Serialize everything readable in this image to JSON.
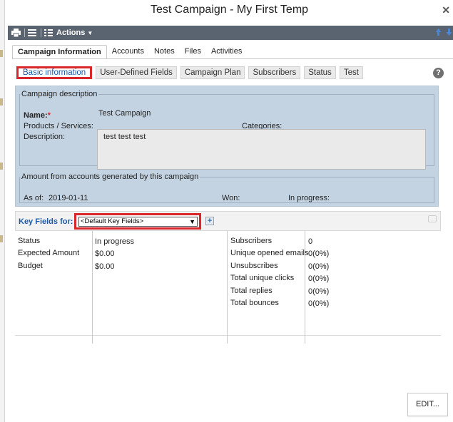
{
  "window": {
    "title": "Test Campaign - My First Temp"
  },
  "toolbar": {
    "actions_label": "Actions"
  },
  "tabs": [
    {
      "label": "Campaign Information",
      "active": true
    },
    {
      "label": "Accounts"
    },
    {
      "label": "Notes"
    },
    {
      "label": "Files"
    },
    {
      "label": "Activities"
    }
  ],
  "subtabs": [
    {
      "label": "Basic information",
      "active": true
    },
    {
      "label": "User-Defined Fields"
    },
    {
      "label": "Campaign Plan"
    },
    {
      "label": "Subscribers"
    },
    {
      "label": "Status"
    },
    {
      "label": "Test"
    }
  ],
  "campaign_description": {
    "legend": "Campaign description",
    "name_label": "Name:",
    "name_required": "*",
    "name_value": "Test Campaign",
    "products_label": "Products / Services:",
    "categories_label": "Categories:",
    "description_label": "Description:",
    "description_value": "test test test"
  },
  "amount": {
    "legend": "Amount from accounts generated by this campaign",
    "as_of_label": "As of:",
    "as_of_value": "2019-01-11",
    "won_label": "Won:",
    "in_progress_label": "In progress:"
  },
  "key_fields": {
    "label": "Key Fields for:",
    "selected": "<Default Key Fields>",
    "left": [
      {
        "label": "Status",
        "value": "In progress"
      },
      {
        "label": "Expected Amount",
        "value": "$0.00"
      },
      {
        "label": "Budget",
        "value": "$0.00"
      }
    ],
    "right": [
      {
        "label": "Subscribers",
        "value": "0"
      },
      {
        "label": "Unique opened emails",
        "value": "0(0%)"
      },
      {
        "label": "Unsubscribes",
        "value": "0(0%)"
      },
      {
        "label": "Total unique clicks",
        "value": "0(0%)"
      },
      {
        "label": "Total replies",
        "value": "0(0%)"
      },
      {
        "label": "Total bounces",
        "value": "0(0%)"
      }
    ]
  },
  "edit_button": {
    "label": "EDIT..."
  },
  "colors": {
    "accent_red": "#d9262b",
    "link_blue": "#1f5aa6",
    "toolbar": "#5a6471",
    "panel": "#c4d3e2"
  }
}
